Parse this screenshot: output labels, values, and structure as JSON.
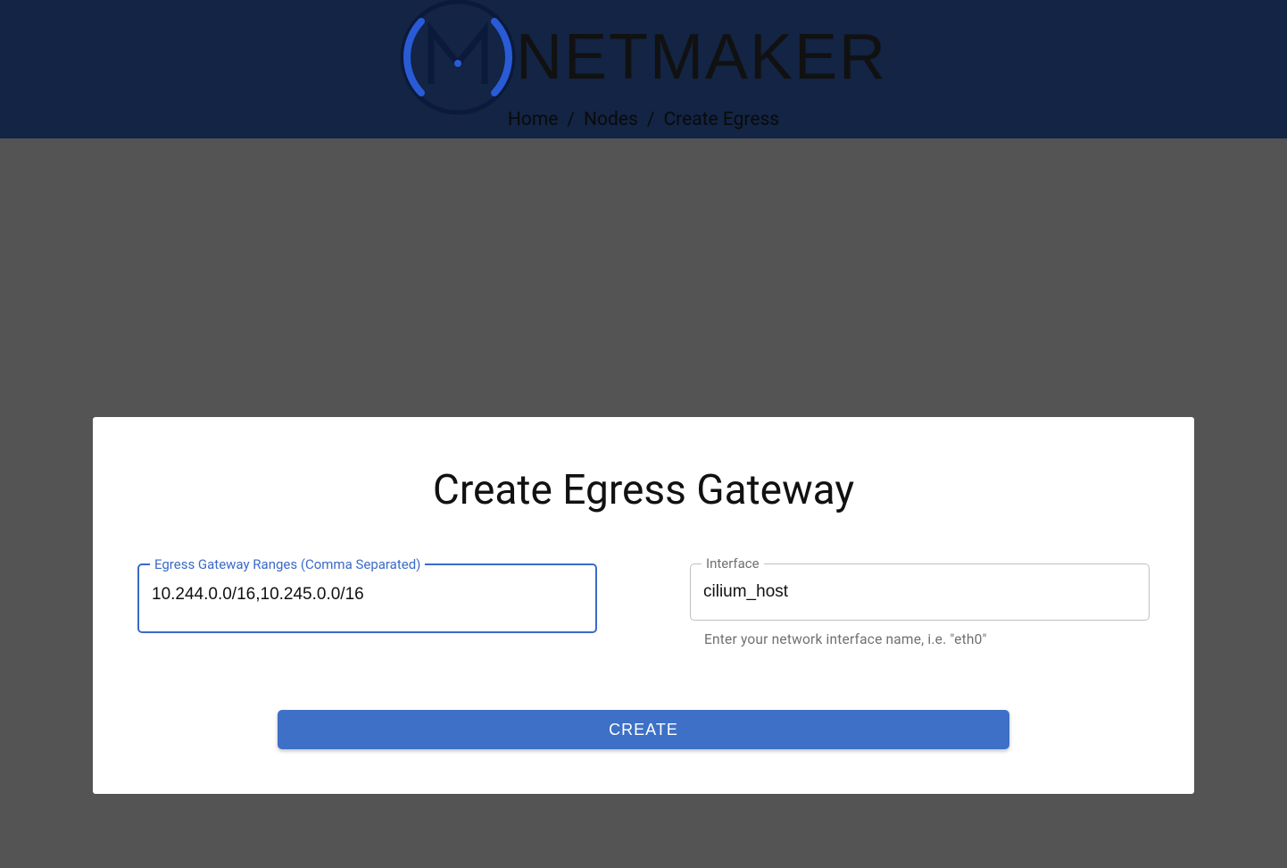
{
  "header": {
    "brand_text": "NETMAKER",
    "breadcrumb": [
      {
        "label": "Home"
      },
      {
        "label": "Nodes"
      },
      {
        "label": "Create Egress"
      }
    ]
  },
  "card": {
    "title": "Create Egress Gateway",
    "fields": {
      "ranges": {
        "label": "Egress Gateway Ranges (Comma Separated)",
        "value": "10.244.0.0/16,10.245.0.0/16"
      },
      "interface": {
        "label": "Interface",
        "value": "cilium_host",
        "helper": "Enter your network interface name, i.e. \"eth0\""
      }
    },
    "create_label": "CREATE"
  }
}
